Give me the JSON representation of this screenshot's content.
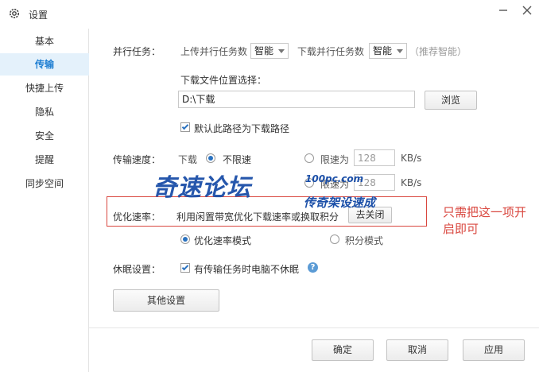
{
  "window": {
    "title": "设置"
  },
  "sidebar": {
    "items": [
      {
        "label": "基本"
      },
      {
        "label": "传输",
        "active": true
      },
      {
        "label": "快捷上传"
      },
      {
        "label": "隐私"
      },
      {
        "label": "安全"
      },
      {
        "label": "提醒"
      },
      {
        "label": "同步空间"
      }
    ]
  },
  "parallel": {
    "label": "并行任务：",
    "upload_label": "上传并行任务数",
    "upload_value": "智能",
    "download_label": "下载并行任务数",
    "download_value": "智能",
    "recommend": "（推荐智能）"
  },
  "download_location": {
    "label": "下载文件位置选择：",
    "path": "D:\\下载",
    "browse_label": "浏览",
    "default_checkbox_label": "默认此路径为下载路径",
    "default_checked": true
  },
  "speed": {
    "label": "传输速度：",
    "download_label": "下载",
    "unlimited_label": "不限速",
    "limit_label": "限速为",
    "download_limit_value": "128",
    "unit": "KB/s",
    "upload_limit_label": "限速为",
    "upload_limit_value": "128",
    "upload_unit": "KB/s",
    "download_mode": "unlimited"
  },
  "optimize": {
    "label": "优化速率：",
    "description": "利用闲置带宽优化下载速率或换取积分",
    "close_button": "去关闭",
    "mode_speed": "优化速率模式",
    "mode_points": "积分模式",
    "selected": "speed"
  },
  "sleep": {
    "label": "休眠设置：",
    "checkbox_label": "有传输任务时电脑不休眠",
    "checked": true
  },
  "other_settings_button": "其他设置",
  "annotation": {
    "line1": "只需把这一项开",
    "line2": "启即可"
  },
  "watermark": {
    "main": "奇速论坛",
    "site": "100pc.com",
    "slogan": "传奇架设速成"
  },
  "footer": {
    "ok": "确定",
    "cancel": "取消",
    "apply": "应用"
  }
}
